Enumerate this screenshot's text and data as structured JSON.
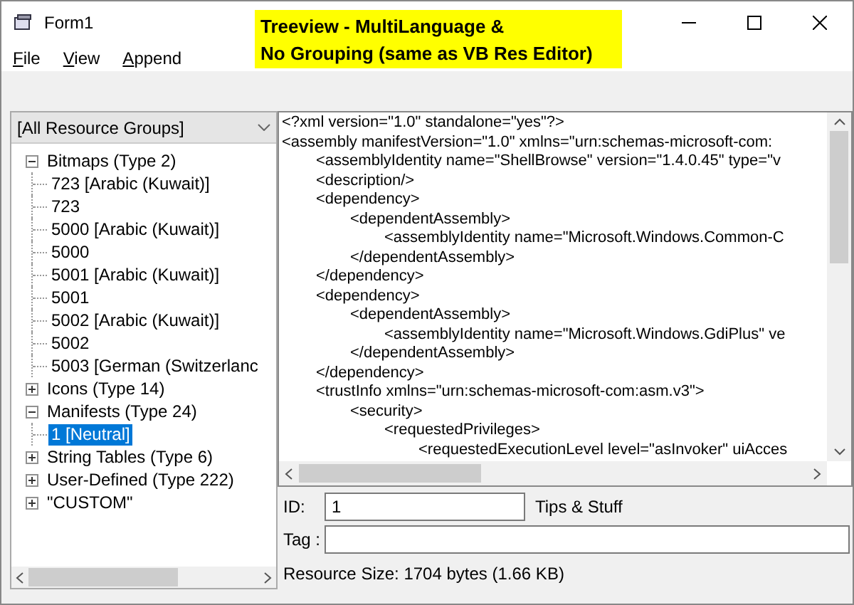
{
  "window": {
    "title": "Form1"
  },
  "banner": [
    "Treeview - MultiLanguage &",
    "No Grouping (same as VB Res Editor)"
  ],
  "menu": [
    {
      "accel": "F",
      "rest": "ile"
    },
    {
      "accel": "V",
      "rest": "iew"
    },
    {
      "accel": "A",
      "rest": "ppend"
    }
  ],
  "group_combo": {
    "value": "[All Resource Groups]"
  },
  "tree": [
    {
      "label": "Bitmaps (Type 2)",
      "expanded": true,
      "selected": false,
      "children": [
        {
          "label": "723 [Arabic (Kuwait)]",
          "selected": false
        },
        {
          "label": "723",
          "selected": false
        },
        {
          "label": "5000 [Arabic (Kuwait)]",
          "selected": false
        },
        {
          "label": "5000",
          "selected": false
        },
        {
          "label": "5001 [Arabic (Kuwait)]",
          "selected": false
        },
        {
          "label": "5001",
          "selected": false
        },
        {
          "label": "5002 [Arabic (Kuwait)]",
          "selected": false
        },
        {
          "label": "5002",
          "selected": false
        },
        {
          "label": "5003 [German (Switzerlanc",
          "selected": false
        }
      ]
    },
    {
      "label": "Icons (Type 14)",
      "expanded": false,
      "selected": false
    },
    {
      "label": "Manifests (Type 24)",
      "expanded": true,
      "selected": false,
      "children": [
        {
          "label": "1 [Neutral]",
          "selected": true
        }
      ]
    },
    {
      "label": "String Tables (Type 6)",
      "expanded": false,
      "selected": false
    },
    {
      "label": "User-Defined (Type 222)",
      "expanded": false,
      "selected": false
    },
    {
      "label": "\"CUSTOM\"",
      "expanded": false,
      "selected": false
    }
  ],
  "content_lines": [
    "<?xml version=\"1.0\" standalone=\"yes\"?>",
    "<assembly manifestVersion=\"1.0\" xmlns=\"urn:schemas-microsoft-com:",
    "\t<assemblyIdentity name=\"ShellBrowse\" version=\"1.4.0.45\" type=\"v",
    "\t<description/>",
    "\t<dependency>",
    "\t\t<dependentAssembly>",
    "\t\t\t<assemblyIdentity name=\"Microsoft.Windows.Common-C",
    "\t\t</dependentAssembly>",
    "\t</dependency>",
    "\t<dependency>",
    "\t\t<dependentAssembly>",
    "\t\t\t<assemblyIdentity name=\"Microsoft.Windows.GdiPlus\" ve",
    "\t\t</dependentAssembly>",
    "\t</dependency>",
    "\t<trustInfo xmlns=\"urn:schemas-microsoft-com:asm.v3\">",
    "\t\t<security>",
    "\t\t\t<requestedPrivileges>",
    "\t\t\t\t<requestedExecutionLevel level=\"asInvoker\" uiAcces"
  ],
  "id_field": {
    "label": "ID:",
    "value": "1"
  },
  "tips_label": "Tips & Stuff",
  "tag_field": {
    "label": "Tag :"
  },
  "resource_size": "Resource Size: 1704 bytes (1.66 KB)"
}
